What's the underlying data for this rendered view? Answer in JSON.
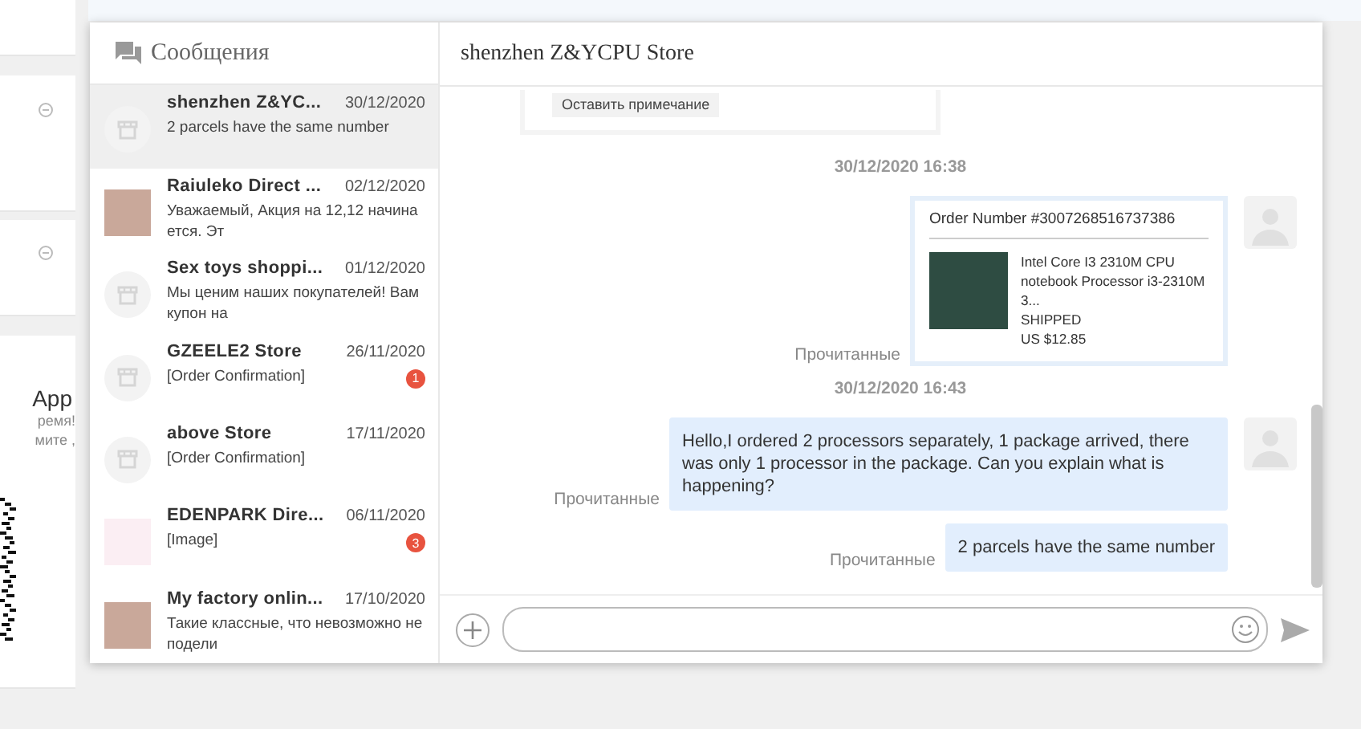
{
  "background": {
    "app_title": "App",
    "app_lines": [
      "ремя!",
      "мите ,"
    ]
  },
  "sidebar": {
    "title": "Сообщения",
    "conversations": [
      {
        "name": "shenzhen Z&YC...",
        "date": "30/12/2020",
        "preview": "2 parcels have the same number",
        "kind": "store",
        "selected": true
      },
      {
        "name": "Raiuleko Direct ...",
        "date": "02/12/2020",
        "preview": "Уважаемый, Акция на 12,12 начинается. Эт",
        "kind": "photo",
        "selected": false
      },
      {
        "name": "Sex toys shoppi...",
        "date": "01/12/2020",
        "preview": "Мы ценим наших покупателей! Вам купон на",
        "kind": "store",
        "selected": false
      },
      {
        "name": "GZEELE2 Store",
        "date": "26/11/2020",
        "preview": "[Order Confirmation]",
        "kind": "store",
        "unread": "1",
        "selected": false
      },
      {
        "name": "above Store",
        "date": "17/11/2020",
        "preview": "[Order Confirmation]",
        "kind": "store",
        "selected": false
      },
      {
        "name": "EDENPARK Dire...",
        "date": "06/11/2020",
        "preview": "[Image]",
        "kind": "logo",
        "unread": "3",
        "selected": false
      },
      {
        "name": "My factory onlin...",
        "date": "17/10/2020",
        "preview": "Такие классные, что невозможно не подели",
        "kind": "photo",
        "selected": false
      }
    ]
  },
  "chat": {
    "title": "shenzhen Z&YCPU Store",
    "messages": [
      {
        "kind": "note",
        "button": "Оставить примечание"
      },
      {
        "kind": "time",
        "text": "30/12/2020 16:38"
      },
      {
        "kind": "order",
        "order_number": "Order Number #3007268516737386",
        "product": "Intel Core I3 2310M CPU notebook Processor i3-2310M 3...",
        "status": "SHIPPED",
        "price": "US $12.85",
        "read_label": "Прочитанные"
      },
      {
        "kind": "time",
        "text": "30/12/2020 16:43"
      },
      {
        "kind": "text",
        "text": "Hello,I ordered 2 processors separately, 1 package arrived, there was only 1 processor in the package. Can you explain what is happening?",
        "read_label": "Прочитанные",
        "avatar": true
      },
      {
        "kind": "text",
        "text": "2 parcels have the same number",
        "read_label": "Прочитанные",
        "avatar": false
      }
    ]
  }
}
